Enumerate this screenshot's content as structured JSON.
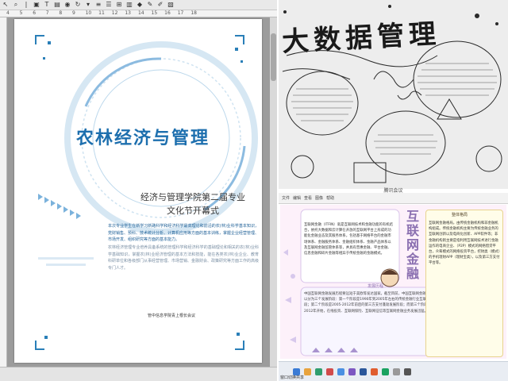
{
  "editor": {
    "ruler_numbers": [
      "4",
      "5",
      "6",
      "7",
      "8",
      "9",
      "10",
      "11",
      "12",
      "13",
      "14",
      "15",
      "16",
      "17",
      "18"
    ],
    "document": {
      "title": "农林经济与管理",
      "subtitle_line1": "经济与管理学院第二届专业",
      "subtitle_line2": "文化节开幕式",
      "paragraph1": "本次专业学生在新学习新路科学和经济科学最高理论和前沿的农(林)业科学基本知识，党财销售、预科、技术统计分析、计算机应用等方面的基本训练，掌握企业经营管理、市场开发、组织研究等方面的基本能力。",
      "paragraph2": "农林经济管理专业培养具备系统的管理科学和经济科学的基础理论和相关的农(林)业科学基础知识，掌握农(林)业经济管理的基本方法和技能，能在各类农(林)业企业、教育科研单位和各级部门从事经营管理、市场营销、金融财会、政策研究等方面工作的高级专门人才。",
      "signature": "管中信息学院青上根长会议"
    }
  },
  "poster1": {
    "title": "大数据管理",
    "caption": "腾讯会议"
  },
  "viewer": {
    "toolbar_items": [
      "文件",
      "编辑",
      "查看",
      "图像",
      "帮助"
    ],
    "poster": {
      "heading": "互联网金融",
      "left_text": "互联网金融（ITFIN）就是互联网技术和金融功能的有机结合，依托大数据和云计算在开放的互联网平台上形成的功能化金融业态及其服务体系，包括基于网络平台的金融市场体系、金融服务体系、金融组织体系、金融产品体系以及互联网金融监管体系等，并具有普惠金融、平台金融、信息金融和碎片金融等相异于传统金融的金融模式。",
      "small_heading": "发展历程",
      "bottom_text": "中国互联网金融发展历程要远短于美欧等发达国家。截至目前，中国互联网金融大致可以分为三个发展阶段：第一个阶段是1990年到2005年左右的传统金融行业互联网化阶段；第二个阶段是2005-2012年前后的第三方支付蓬勃发展阶段；而第三个阶段从2012年开始，在线投资、互联网保险、互联网征信等互联网金融业务发展迅猛。",
      "right_heading": "整体格局",
      "right_text": "互联网金融格局，由传统金融机构和非金融机构组成。传统金融机构主要为传统金融业务的互联网创新以及电商化创新、APP软件等；非金融机构则主要是指利用互联网技术进行金融运作的电商企业、（P2P）模式的网络借贷平台，众筹模式的网络投资平台，挖财类（模式）的手机理财APP（理财宝类），以及第三方支付平台等。"
    },
    "task_label": "窗口切换共享"
  },
  "colors": {
    "doc_blue": "#1d6fae",
    "accent_purple": "#8a6fb0"
  }
}
